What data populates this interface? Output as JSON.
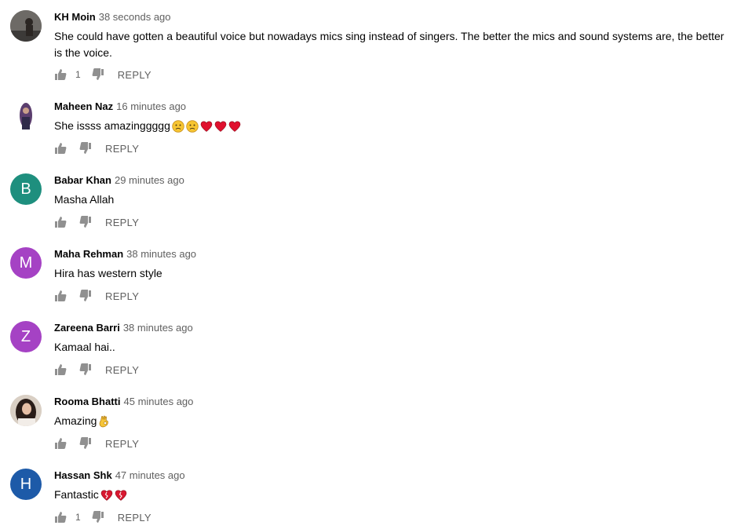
{
  "comments": [
    {
      "author": "KH Moin",
      "time": "38 seconds ago",
      "text": "She could have gotten a beautiful voice but nowadays mics sing instead of singers. The better the mics and sound systems are, the better is the voice.",
      "likes": "1",
      "reply": "REPLY",
      "avatar_letter": "",
      "avatar_color": "#6b6b6b",
      "emojis": []
    },
    {
      "author": "Maheen Naz",
      "time": "16 minutes ago",
      "text": "She issss amazinggggg",
      "likes": "",
      "reply": "REPLY",
      "avatar_letter": "",
      "avatar_color": "#8a6a8a",
      "emojis": [
        "frown",
        "frown",
        "heart",
        "heart",
        "heart"
      ]
    },
    {
      "author": "Babar Khan",
      "time": "29 minutes ago",
      "text": "Masha Allah",
      "likes": "",
      "reply": "REPLY",
      "avatar_letter": "B",
      "avatar_color": "#1e8f7e",
      "emojis": []
    },
    {
      "author": "Maha Rehman",
      "time": "38 minutes ago",
      "text": "Hira has western style",
      "likes": "",
      "reply": "REPLY",
      "avatar_letter": "M",
      "avatar_color": "#a542c4",
      "emojis": []
    },
    {
      "author": "Zareena Barri",
      "time": "38 minutes ago",
      "text": "Kamaal hai..",
      "likes": "",
      "reply": "REPLY",
      "avatar_letter": "Z",
      "avatar_color": "#a542c4",
      "emojis": []
    },
    {
      "author": "Rooma Bhatti",
      "time": "45 minutes ago",
      "text": "Amazing",
      "likes": "",
      "reply": "REPLY",
      "avatar_letter": "",
      "avatar_color": "#c9b7a6",
      "emojis": [
        "ok-hand"
      ]
    },
    {
      "author": "Hassan Shk",
      "time": "47 minutes ago",
      "text": "Fantastic",
      "likes": "1",
      "reply": "REPLY",
      "avatar_letter": "H",
      "avatar_color": "#1d5aa8",
      "emojis": [
        "broken-heart",
        "broken-heart"
      ]
    }
  ]
}
